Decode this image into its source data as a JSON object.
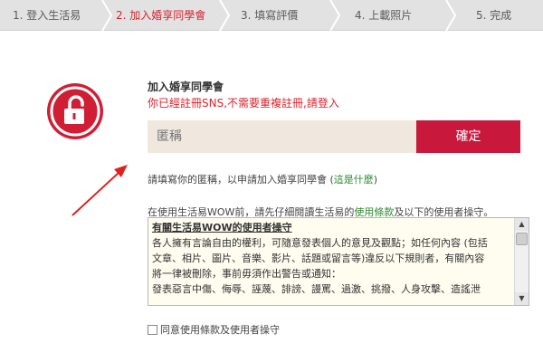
{
  "steps": [
    {
      "label": "1. 登入生活易",
      "active": false
    },
    {
      "label": "2. 加入婚享同學會",
      "active": true
    },
    {
      "label": "3. 填寫評價",
      "active": false
    },
    {
      "label": "4. 上載照片",
      "active": false
    },
    {
      "label": "5. 完成",
      "active": false
    }
  ],
  "icon": "unlock-icon",
  "form": {
    "heading": "加入婚享同學會",
    "warning": "你已經註冊SNS,不需要重複註冊,請登入",
    "nickname_placeholder": "匿稱",
    "confirm_label": "確定",
    "hint_prefix": "請填寫你的匿稱，以申請加入婚享同學會 (",
    "hint_link": "這是什麼",
    "hint_suffix": ")"
  },
  "terms": {
    "intro_prefix": "在使用生活易WOW前，請先仔細閱讀生活易的",
    "intro_link": "使用條款",
    "intro_suffix": "及以下的使用者操守。",
    "title": "有關生活易WOW的使用者操守",
    "lines": [
      "各人擁有言論自由的權利，可隨意發表個人的意見及觀點；如任何內容 (包括",
      "文章、相片、圖片、音樂、影片、話題或留言等)違反以下規則者，有關內容",
      "將一律被刪除，事前毋須作出警告或通知：",
      "發表惡言中傷、侮辱、誣蔑、誹謗、謾罵、過激、挑撥、人身攻擊、造謠泄"
    ],
    "agree_label": "同意使用條款及使用者操守"
  },
  "colors": {
    "accent": "#d9232e",
    "button": "#c8183c",
    "field_bg": "#f0e8df",
    "link": "#2d8a2d"
  }
}
